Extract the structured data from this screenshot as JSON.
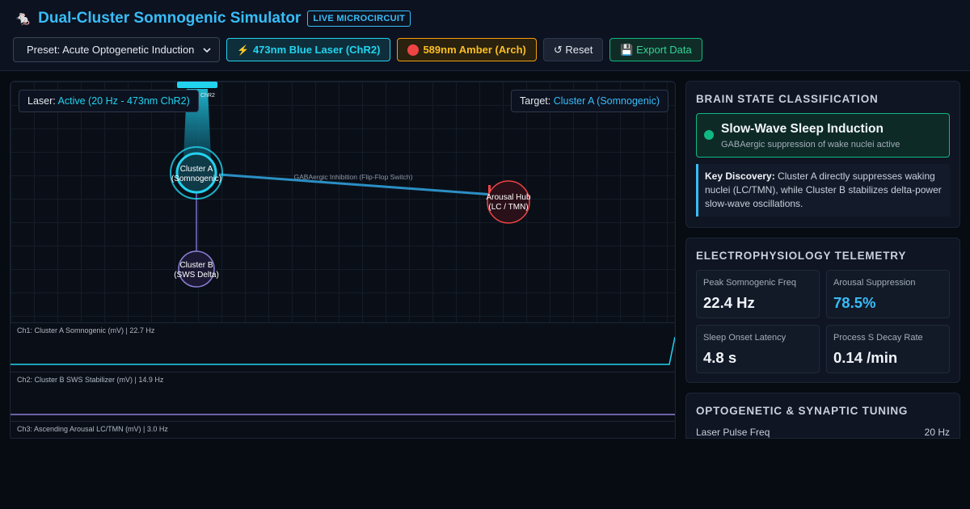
{
  "header": {
    "logo_glyph": "🐁",
    "title": "Dual-Cluster Somnogenic Simulator",
    "badge": "LIVE MICROCIRCUIT"
  },
  "toolbar": {
    "preset_value": "Preset: Acute Optogenetic Induction",
    "blue_laser": "473nm Blue Laser (ChR2)",
    "amber_laser": "589nm Amber (Arch)",
    "reset": "↺ Reset",
    "export": "💾 Export Data"
  },
  "canvas": {
    "laser_prefix": "Laser: ",
    "laser_value": "Active (20 Hz - 473nm ChR2)",
    "target_prefix": "Target: ",
    "target_value": "Cluster A (Somnogenic)",
    "chr2_label": "ChR2",
    "connection_label": "GABAergic Inhibition (Flip-Flop Switch)",
    "nodes": {
      "cluster_a_line1": "Cluster A",
      "cluster_a_line2": "(Somnogenic)",
      "arousal_line1": "Arousal Hub",
      "arousal_line2": "(LC / TMN)",
      "cluster_b_line1": "Cluster B",
      "cluster_b_line2": "(SWS Delta)"
    },
    "traces": [
      {
        "label": "Ch1: Cluster A Somnogenic (mV) | 22.7 Hz",
        "color": "#22d3ee"
      },
      {
        "label": "Ch2: Cluster B SWS Stabilizer (mV) | 14.9 Hz",
        "color": "#8b7fd6"
      },
      {
        "label": "Ch3: Ascending Arousal LC/TMN (mV) | 3.0 Hz",
        "color": "#ef4444"
      }
    ]
  },
  "brain_state": {
    "title": "BRAIN STATE CLASSIFICATION",
    "state": "Slow-Wave Sleep Induction",
    "state_sub": "GABAergic suppression of wake nuclei active",
    "discovery_label": "Key Discovery:",
    "discovery_text": " Cluster A directly suppresses waking nuclei (LC/TMN), while Cluster B stabilizes delta-power slow-wave oscillations."
  },
  "telemetry": {
    "title": "ELECTROPHYSIOLOGY TELEMETRY",
    "metrics": [
      {
        "label": "Peak Somnogenic Freq",
        "value": "22.4 Hz"
      },
      {
        "label": "Arousal Suppression",
        "value": "78.5%"
      },
      {
        "label": "Sleep Onset Latency",
        "value": "4.8 s"
      },
      {
        "label": "Process S Decay Rate",
        "value": "0.14 /min"
      }
    ]
  },
  "tuning": {
    "title": "OPTOGENETIC & SYNAPTIC TUNING",
    "rows": [
      {
        "label": "Laser Pulse Freq",
        "value": "20 Hz"
      }
    ]
  }
}
